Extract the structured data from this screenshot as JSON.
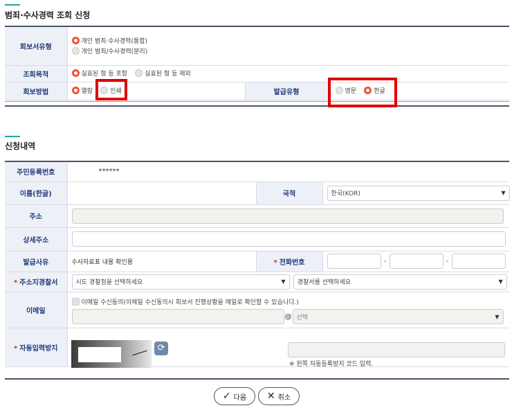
{
  "section1": {
    "title": "범죄·수사경력 조회 신청",
    "rows": {
      "report_type": {
        "label": "회보서유형",
        "options": [
          "개인 범죄·수사경력(통합)",
          "개인 범죄/수사경력(분리)"
        ],
        "selected": 0
      },
      "purpose": {
        "label": "조회목적",
        "options": [
          "실효된 형 등 포함",
          "실효된 형 등 제외"
        ],
        "selected": 0
      },
      "method": {
        "label": "회보방법",
        "options": [
          "열람",
          "인쇄"
        ],
        "selected": 0
      },
      "issue_type": {
        "label": "발급유형",
        "options": [
          "영문",
          "한글"
        ],
        "selected": 1
      }
    }
  },
  "section2": {
    "title": "신청내역",
    "rrn": {
      "label": "주민등록번호",
      "value": "******"
    },
    "name": {
      "label": "이름(한글)"
    },
    "nationality": {
      "label": "국적",
      "value": "한국(KOR)"
    },
    "address": {
      "label": "주소"
    },
    "address_detail": {
      "label": "상세주소"
    },
    "issue_reason": {
      "label": "발급사유",
      "value": "수사자료표 내용 확인용"
    },
    "phone": {
      "label": "전화번호",
      "required_mark": "*",
      "separator": "-"
    },
    "police": {
      "label": "주소지경찰서",
      "required_mark": "*",
      "province_placeholder": "시도 경찰청을 선택하세요",
      "station_placeholder": "경찰서를 선택하세요"
    },
    "email": {
      "label": "이메일",
      "consent_text": "이메일 수신동의(이메일 수신동의시 회보서 진행상황을 메일로 확인할 수 있습니다.)",
      "at": "@",
      "domain_placeholder": "선택"
    },
    "captcha": {
      "label": "자동입력방지",
      "required_mark": "*",
      "hint": "※ 왼쪽 자동등록방지 코드 입력."
    }
  },
  "buttons": {
    "next": "다음",
    "cancel": "취소"
  },
  "icons": {
    "next": "check-icon",
    "cancel": "x-icon",
    "refresh": "refresh-icon",
    "select": "dropdown-arrow-icon"
  },
  "colors": {
    "accent": "#1fa89a",
    "label_bg": "#eef0f8",
    "label_text": "#1f3a78",
    "radio_on": "#e8543e",
    "highlight_box": "#e20000"
  }
}
